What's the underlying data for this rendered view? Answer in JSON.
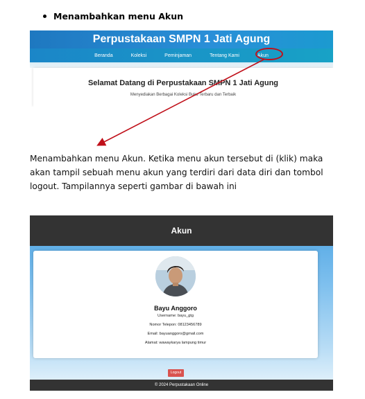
{
  "document": {
    "bullet_heading": "Menambahkan menu Akun",
    "paragraph": "Menambahkan menu Akun. Ketika menu akun tersebut di (klik) maka akan tampil sebuah menu akun yang terdiri dari data diri dan tombol logout. Tampilannya seperti gambar di bawah ini"
  },
  "screenshot1": {
    "site_title": "Perpustakaan SMPN 1 Jati Agung",
    "nav": [
      "Beranda",
      "Koleksi",
      "Peminjaman",
      "Tentang Kami",
      "Akun"
    ],
    "welcome_title": "Selamat Datang di Perpustakaan SMPN 1 Jati Agung",
    "welcome_subtitle": "Menyediakan Berbagai Koleksi Buku Terbaru dan Terbaik",
    "annotation_color": "#c0101a"
  },
  "screenshot2": {
    "header_title": "Akun",
    "avatar_icon": "user-photo",
    "name": "Bayu Anggoro",
    "username": "Username: bayu_gtg",
    "phone": "Nomor Telepon: 08123456789",
    "email": "Email: bayuanggoro@gmail.com",
    "address": "Alamat: wawaykarya lampung timur",
    "logout_label": "Logout",
    "footer": "© 2024 Perpustakaan Online",
    "header_color": "#333333",
    "logout_color": "#d9534f"
  }
}
